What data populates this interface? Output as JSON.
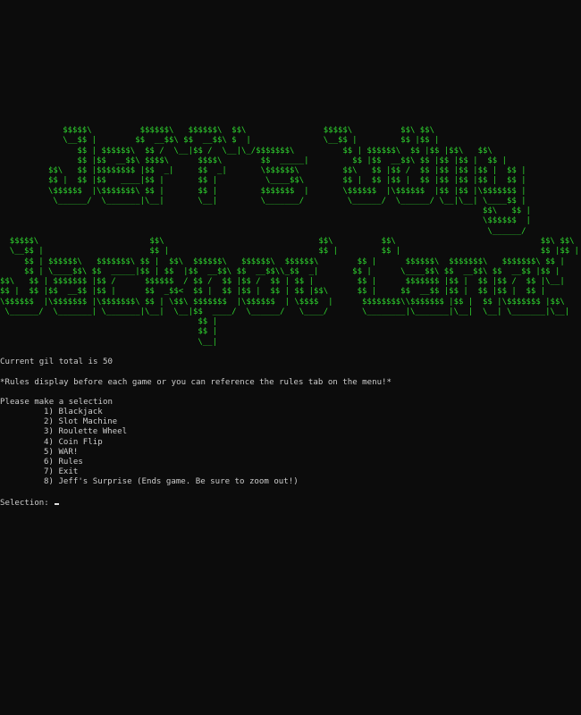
{
  "banner": {
    "top": "             $$$$$\\          $$$$$$\\   $$$$$$\\  $$\\                $$$$$\\          $$\\ $$\\\n             \\__$$ |        $$  __$$\\ $$  __$$\\ $  |               \\__$$ |         $$ |$$ |\n                $$ | $$$$$$\\  $$ /  \\__|$$ /  \\__|\\_/$$$$$$$\\          $$ | $$$$$$\\  $$ |$$ |$$\\   $$\\\n                $$ |$$  __$$\\ $$$$\\      $$$$\\        $$  _____|         $$ |$$  __$$\\ $$ |$$ |$$ |  $$ |\n          $$\\   $$ |$$$$$$$$ |$$  _|     $$  _|       \\$$$$$$\\         $$\\   $$ |$$ /  $$ |$$ |$$ |$$ |  $$ |\n          $$ |  $$ |$$   ____|$$ |       $$ |          \\____$$\\        $$ |  $$ |$$ |  $$ |$$ |$$ |$$ |  $$ |\n          \\$$$$$$  |\\$$$$$$$\\ $$ |       $$ |         $$$$$$$  |       \\$$$$$$  |\\$$$$$$  |$$ |$$ |\\$$$$$$$ |\n           \\______/  \\_______|\\__|       \\__|         \\_______/         \\______/  \\______/ \\__|\\__| \\____$$ |\n                                                                                                    $$\\   $$ |\n                                                                                                    \\$$$$$$  |\n                                                                                                     \\______/",
    "bottom": "  $$$$$\\                       $$\\                                $$\\          $$\\                              $$\\ $$\\\n  \\__$$ |                      $$ |                               $$ |         $$ |                             $$ |$$ |\n     $$ | $$$$$$\\   $$$$$$$\\ $$ |  $$\\  $$$$$$\\   $$$$$$\\  $$$$$$\\        $$ |      $$$$$$\\  $$$$$$$\\   $$$$$$$\\ $$ |\n     $$ | \\____$$\\ $$  _____|$$ | $$  |$$  __$$\\ $$  __$$\\\\_$$  _|       $$ |      \\____$$\\ $$  __$$\\ $$  __$$ |$$ |\n$$\\   $$ | $$$$$$$ |$$ /      $$$$$$  / $$ /  $$ |$$ /  $$ | $$ |         $$ |      $$$$$$$ |$$ |  $$ |$$ /  $$ |\\__|\n$$ |  $$ |$$  __$$ |$$ |      $$  _$$<  $$ |  $$ |$$ |  $$ | $$ |$$\\      $$ |     $$  __$$ |$$ |  $$ |$$ |  $$ |\n\\$$$$$$  |\\$$$$$$$ |\\$$$$$$$\\ $$ | \\$$\\ $$$$$$$  |\\$$$$$$  | \\$$$$  |      $$$$$$$$\\\\$$$$$$$ |$$ |  $$ |\\$$$$$$$ |$$\\\n \\______/  \\_______| \\_______|\\__|  \\__|$$  ____/  \\______/   \\____/       \\________|\\_______|\\__|  \\__| \\_______|\\__|\n                                         $$ |\n                                         $$ |\n                                         \\__|"
  },
  "status": {
    "gil_text": "Current gil total is 50",
    "rules_note": "*Rules display before each game or you can reference the rules tab on the menu!*"
  },
  "menu": {
    "prompt": "Please make a selection",
    "items": [
      {
        "number": "1)",
        "label": "Blackjack"
      },
      {
        "number": "2)",
        "label": "Slot Machine"
      },
      {
        "number": "3)",
        "label": "Roulette Wheel"
      },
      {
        "number": "4)",
        "label": "Coin Flip"
      },
      {
        "number": "5)",
        "label": "WAR!"
      },
      {
        "number": "6)",
        "label": "Rules"
      },
      {
        "number": "7)",
        "label": "Exit"
      },
      {
        "number": "8)",
        "label": "Jeff's Surprise (Ends game. Be sure to zoom out!)"
      }
    ]
  },
  "input": {
    "label": "Selection: "
  },
  "colors": {
    "background": "#0c0c0c",
    "banner": "#2fd52f",
    "text": "#cccccc"
  }
}
